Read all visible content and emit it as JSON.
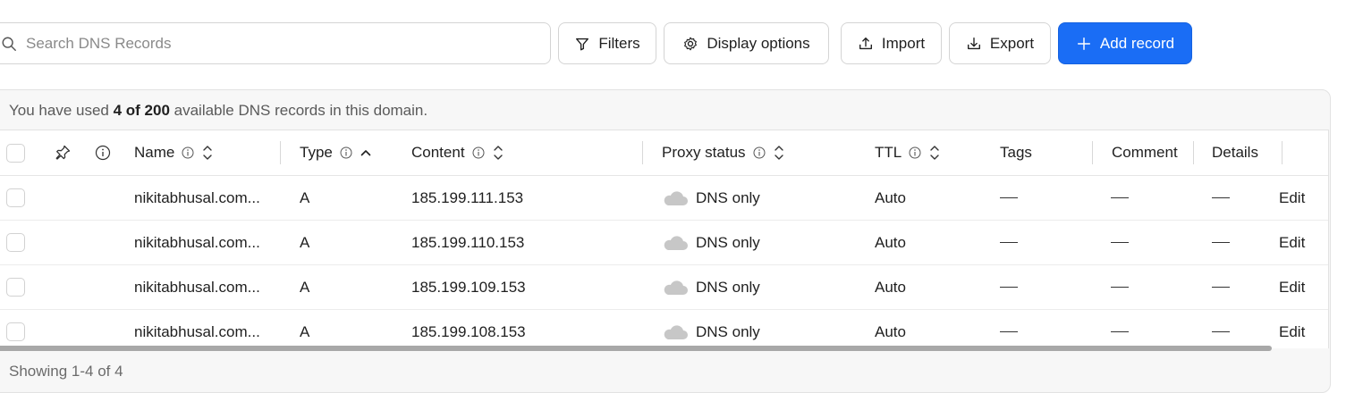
{
  "toolbar": {
    "search_placeholder": "Search DNS Records",
    "filters_label": "Filters",
    "display_options_label": "Display options",
    "import_label": "Import",
    "export_label": "Export",
    "add_record_label": "Add record"
  },
  "usage": {
    "prefix": "You have used ",
    "count": "4 of 200",
    "suffix": " available DNS records in this domain."
  },
  "columns": {
    "name": "Name",
    "type": "Type",
    "content": "Content",
    "proxy_status": "Proxy status",
    "ttl": "TTL",
    "tags": "Tags",
    "comment": "Comment",
    "details": "Details"
  },
  "rows": [
    {
      "name": "nikitabhusal.com...",
      "type": "A",
      "content": "185.199.111.153",
      "proxy": "DNS only",
      "ttl": "Auto",
      "edit": "Edit"
    },
    {
      "name": "nikitabhusal.com...",
      "type": "A",
      "content": "185.199.110.153",
      "proxy": "DNS only",
      "ttl": "Auto",
      "edit": "Edit"
    },
    {
      "name": "nikitabhusal.com...",
      "type": "A",
      "content": "185.199.109.153",
      "proxy": "DNS only",
      "ttl": "Auto",
      "edit": "Edit"
    },
    {
      "name": "nikitabhusal.com...",
      "type": "A",
      "content": "185.199.108.153",
      "proxy": "DNS only",
      "ttl": "Auto",
      "edit": "Edit"
    }
  ],
  "footer": {
    "showing": "Showing 1-4 of 4"
  },
  "colors": {
    "primary": "#1a6df5",
    "cloud_gray": "#c7c7c7"
  },
  "icons": {
    "search": "search-icon",
    "filters": "funnel-icon",
    "display_options": "gear-icon",
    "import": "upload-icon",
    "export": "download-icon",
    "add": "plus-icon",
    "pin": "pin-icon",
    "info": "info-icon",
    "sort": "sort-icon",
    "cloud": "cloud-icon"
  }
}
